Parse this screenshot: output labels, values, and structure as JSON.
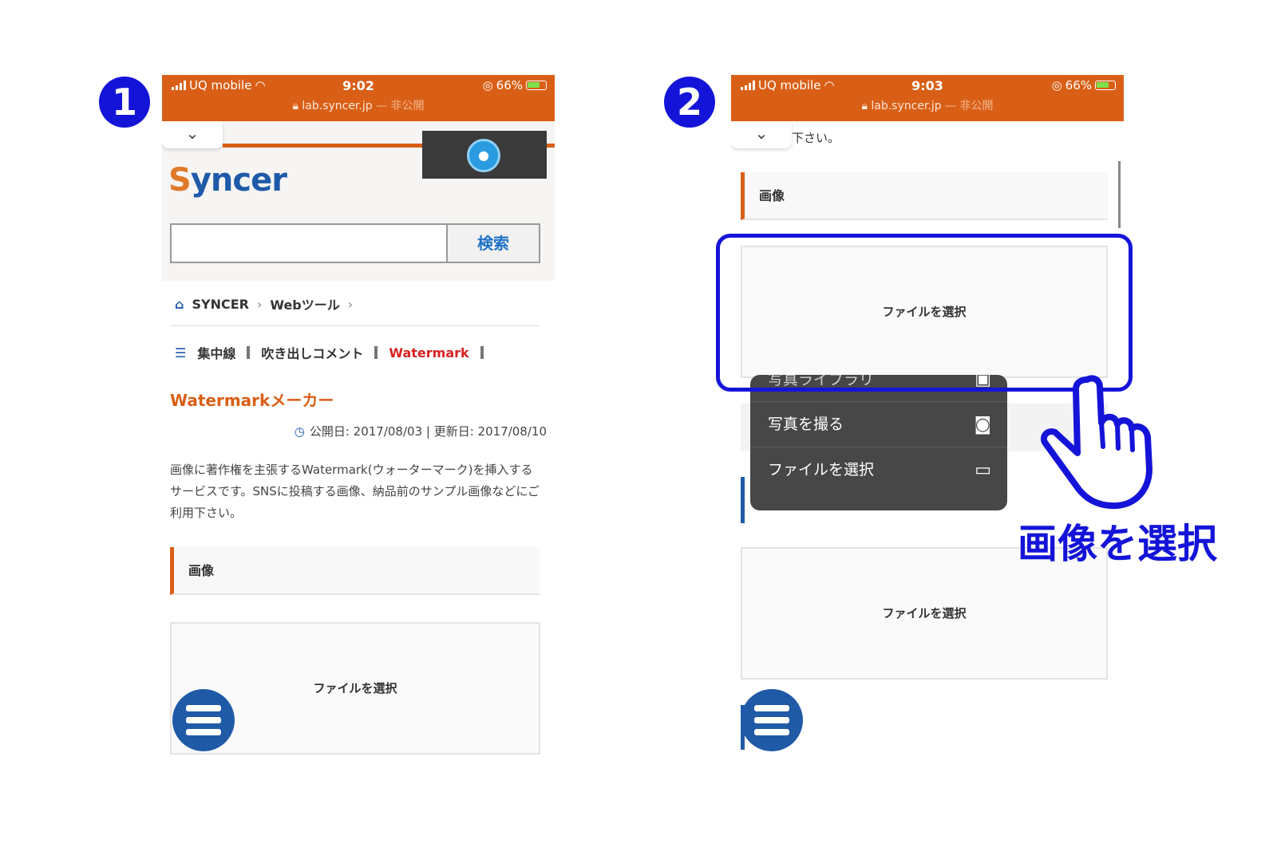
{
  "steps": [
    {
      "number": "1"
    },
    {
      "number": "2"
    }
  ],
  "phone1": {
    "status": {
      "carrier": "UQ mobile",
      "time": "9:02",
      "battery": "66%",
      "url": "lab.syncer.jp",
      "visibility": "— 非公開"
    },
    "logo": {
      "text": "yncer",
      "initial": "S"
    },
    "search": {
      "button": "検索",
      "value": ""
    },
    "breadcrumb": [
      "SYNCER",
      "Webツール"
    ],
    "related": [
      "集中線",
      "吹き出しコメント",
      "Watermark"
    ],
    "title": "Watermarkメーカー",
    "dates": "公開日: 2017/08/03 | 更新日: 2017/08/10",
    "intro": "画像に著作権を主張するWatermark(ウォーターマーク)を挿入するサービスです。SNSに投稿する画像、納品前のサンプル画像などにご利用下さい。",
    "section": "画像",
    "file_button": "ファイルを選択"
  },
  "phone2": {
    "status": {
      "carrier": "UQ mobile",
      "time": "9:03",
      "battery": "66%",
      "url": "lab.syncer.jp",
      "visibility": "— 非公開"
    },
    "top_text": "下さい。",
    "section": "画像",
    "file_button_1": "ファイルを選択",
    "file_button_2": "ファイルを選択",
    "menu": [
      {
        "label": "写真ライブラリ",
        "icon": "photo-library-icon"
      },
      {
        "label": "写真を撮る",
        "icon": "camera-icon"
      },
      {
        "label": "ファイルを選択",
        "icon": "folder-icon"
      }
    ]
  },
  "annotation": {
    "callout": "画像を選択"
  },
  "colors": {
    "accent": "#d95f17",
    "brand_blue": "#1f5aa6",
    "annotation_blue": "#1414d9",
    "active_link": "#d82020"
  }
}
